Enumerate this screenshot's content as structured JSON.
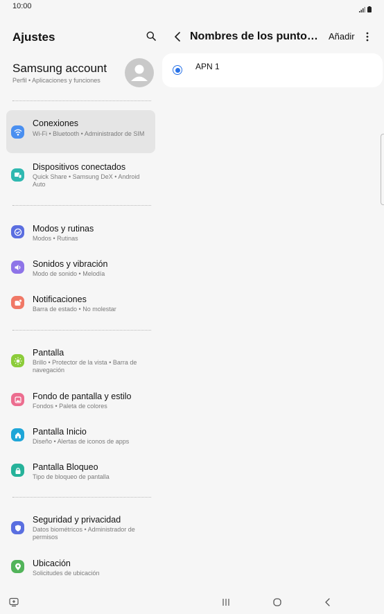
{
  "status": {
    "time": "10:00"
  },
  "left": {
    "title": "Ajustes",
    "account": {
      "title": "Samsung account",
      "subtitle": "Perfil • Aplicaciones y funciones"
    },
    "items": [
      {
        "title": "Conexiones",
        "subtitle": "Wi-Fi • Bluetooth • Administrador de SIM",
        "icon": "wifi-icon",
        "color": "#4a8ff0"
      },
      {
        "title": "Dispositivos conectados",
        "subtitle": "Quick Share • Samsung DeX • Android Auto",
        "icon": "devices-icon",
        "color": "#2fb8b0"
      },
      {
        "title": "Modos y rutinas",
        "subtitle": "Modos • Rutinas",
        "icon": "check-circle-icon",
        "color": "#5b6ee0"
      },
      {
        "title": "Sonidos y vibración",
        "subtitle": "Modo de sonido • Melodía",
        "icon": "volume-icon",
        "color": "#8e74e8"
      },
      {
        "title": "Notificaciones",
        "subtitle": "Barra de estado • No molestar",
        "icon": "notification-icon",
        "color": "#f07866"
      },
      {
        "title": "Pantalla",
        "subtitle": "Brillo • Protector de la vista • Barra de navegación",
        "icon": "brightness-icon",
        "color": "#8ccc3a"
      },
      {
        "title": "Fondo de pantalla y estilo",
        "subtitle": "Fondos • Paleta de colores",
        "icon": "wallpaper-icon",
        "color": "#ec6d8f"
      },
      {
        "title": "Pantalla Inicio",
        "subtitle": "Diseño • Alertas de iconos de apps",
        "icon": "home-icon",
        "color": "#1fa6d8"
      },
      {
        "title": "Pantalla Bloqueo",
        "subtitle": "Tipo de bloqueo de pantalla",
        "icon": "lock-icon",
        "color": "#26b29a"
      },
      {
        "title": "Seguridad y privacidad",
        "subtitle": "Datos biométricos • Administrador de permisos",
        "icon": "shield-icon",
        "color": "#5a6fe0"
      },
      {
        "title": "Ubicación",
        "subtitle": "Solicitudes de ubicación",
        "icon": "location-icon",
        "color": "#52b45a"
      }
    ]
  },
  "right": {
    "title": "Nombres de los puntos de acceso",
    "add_label": "Añadir",
    "apn": {
      "name": "APN 1",
      "selected": true
    }
  }
}
